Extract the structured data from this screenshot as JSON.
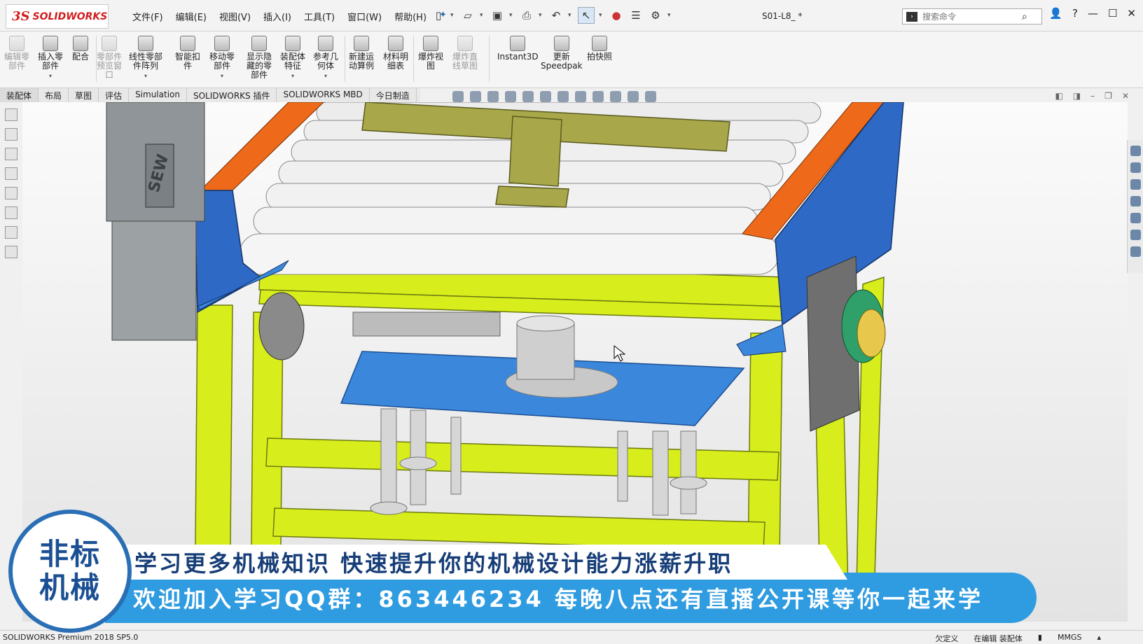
{
  "app": {
    "brand_ds": "3S",
    "brand_name": "SOLIDWORKS",
    "document_title": "S01-L8_ *"
  },
  "menu": [
    "文件(F)",
    "编辑(E)",
    "视图(V)",
    "插入(I)",
    "工具(T)",
    "窗口(W)",
    "帮助(H)"
  ],
  "search": {
    "placeholder": "搜索命令"
  },
  "ribbon": {
    "buttons": [
      {
        "label": "编辑零\n部件",
        "disabled": true
      },
      {
        "label": "插入零\n部件",
        "disabled": false
      },
      {
        "label": "配合",
        "disabled": false
      },
      {
        "label": "零部件\n预览窗\n口",
        "disabled": true
      },
      {
        "label": "线性零部\n件阵列",
        "disabled": false
      },
      {
        "label": "智能扣\n件",
        "disabled": false
      },
      {
        "label": "移动零\n部件",
        "disabled": false
      },
      {
        "label": "显示隐\n藏的零\n部件",
        "disabled": false
      },
      {
        "label": "装配体\n特征",
        "disabled": false
      },
      {
        "label": "参考几\n何体",
        "disabled": false
      },
      {
        "label": "新建运\n动算例",
        "disabled": false
      },
      {
        "label": "材料明\n细表",
        "disabled": false
      },
      {
        "label": "爆炸视\n图",
        "disabled": false
      },
      {
        "label": "爆炸直\n线草图",
        "disabled": true
      },
      {
        "label": "Instant3D",
        "disabled": false
      },
      {
        "label": "更新\nSpeedpak",
        "disabled": false
      },
      {
        "label": "拍快照",
        "disabled": false
      }
    ]
  },
  "tabs": [
    "装配体",
    "布局",
    "草图",
    "评估",
    "Simulation",
    "SOLIDWORKS 插件",
    "SOLIDWORKS MBD",
    "今日制造"
  ],
  "model": {
    "motor_brand": "SEW"
  },
  "overlay": {
    "logo_line1": "非标",
    "logo_line2": "机械",
    "line1": "学习更多机械知识 快速提升你的机械设计能力涨薪升职",
    "line2": "欢迎加入学习QQ群：863446234 每晚八点还有直播公开课等你一起来学"
  },
  "status": {
    "left": "SOLIDWORKS Premium 2018 SP5.0",
    "under_defined": "欠定义",
    "editing": "在编辑 装配体",
    "units": "MMGS"
  },
  "colors": {
    "frame_yellow": "#d8ee1c",
    "guard_orange": "#ee6a1a",
    "side_blue": "#2e69c5",
    "plate_blue": "#3b87dc",
    "banner_blue": "#2f9be0",
    "logo_text": "#1b4f93"
  }
}
